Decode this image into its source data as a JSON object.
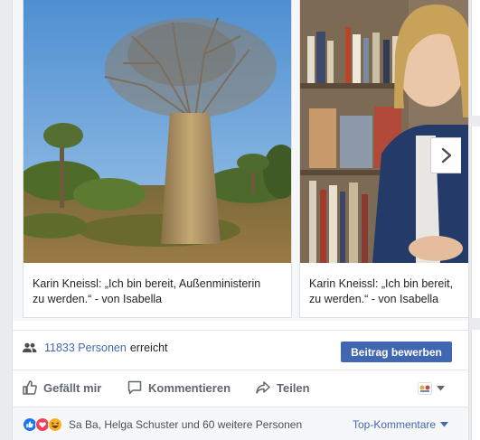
{
  "carousel": {
    "cards": [
      {
        "caption": "Karin Kneissl: „Ich bin bereit, Außenministerin\nzu werden.“ - von Isabella"
      },
      {
        "caption": "Karin Kneissl: „Ich bin bereit,\nzu werden.“ - von Isabella"
      }
    ]
  },
  "reach": {
    "count": "11833 Personen",
    "suffix": "erreicht",
    "promote_label": "Beitrag bewerben"
  },
  "actions": {
    "like": "Gefällt mir",
    "comment": "Kommentieren",
    "share": "Teilen"
  },
  "reactions": {
    "names": "Sa Ba, Helga Schuster und 60 weitere Personen",
    "top_comments": "Top-Kommentare"
  },
  "colors": {
    "accent": "#4267b2",
    "like_blue": "#1877f2",
    "love_red": "#f33e58",
    "haha_yellow": "#f7b125"
  }
}
